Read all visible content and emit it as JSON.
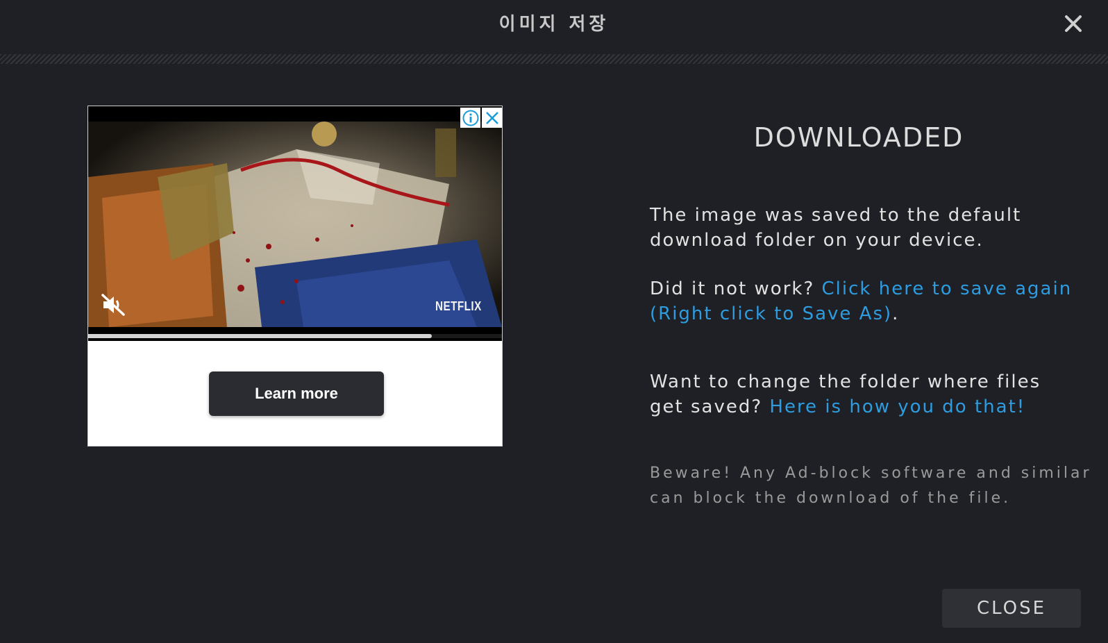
{
  "header": {
    "title": "이미지 저장",
    "close_icon": "close-icon"
  },
  "ad": {
    "brand": "NETFLIX",
    "cta_label": "Learn more",
    "progress_fraction": 0.83,
    "info_icon": "info-icon",
    "close_icon": "close-icon",
    "mute_icon": "muted-speaker-icon"
  },
  "content": {
    "title": "DOWNLOADED",
    "saved_message": "The image was saved to the default download folder on your device.",
    "retry_prefix": "Did it not work? ",
    "retry_link": "Click here to save again (Right click to Save As)",
    "retry_suffix": ".",
    "folder_prefix": "Want to change the folder where files get saved? ",
    "folder_link": "Here is how you do that!",
    "warning": "Beware! Any Ad-block software and similar can block the download of the file."
  },
  "footer": {
    "close_label": "CLOSE"
  },
  "colors": {
    "background": "#1f2025",
    "link": "#2d9ce0",
    "button": "#2e3036"
  }
}
